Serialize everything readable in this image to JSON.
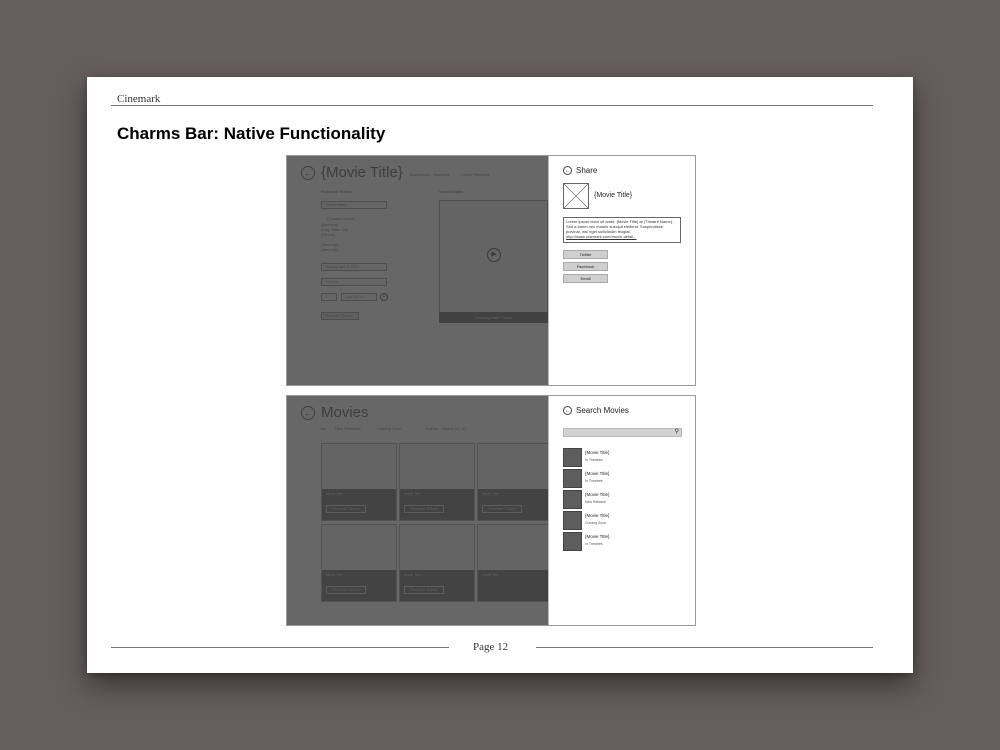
{
  "document": {
    "header": "Cinemark",
    "title": "Charms Bar: Native Functionality",
    "page_number": "Page 12"
  },
  "share_screen": {
    "app": {
      "title": "{Movie Title}",
      "nav": [
        "Showtimes",
        "Synopsis",
        "Critics' Reviews"
      ],
      "section_left": "Purchase Tickets",
      "section_right": "Movie Details",
      "theatre_select": "Theatre Name",
      "theatre_name": "{Theatre Name}",
      "address_lines": [
        "{Address}",
        "{City, State Zip}",
        "{Phone}"
      ],
      "extra_lines": [
        "{Amenity}",
        "{Amenity}"
      ],
      "date_select": "Monday, April 8, 2013",
      "time_select": "7:10 pm",
      "qty_select": "2",
      "type_select": "Adult $11.00",
      "purchase_button": "Purchase Tickets",
      "video_caption": "Opening Date: Today"
    },
    "pane": {
      "title": "Share",
      "movie_title": "{Movie Title}",
      "message_text": "Lorem ipsum dolor sit amet, {Movie Title} at {Theatre Name}. Sed a lorem nec mauris suscipit eleifend. Suspendisse pulvinar, nisi eget sollicitudin feugiat.",
      "message_link": "http://www.cinemark.com/movie-detail..."
    },
    "buttons": [
      "Twitter",
      "Facebook",
      "Email"
    ]
  },
  "search_screen": {
    "app": {
      "title": "Movies",
      "filters": [
        "All",
        "New Releases",
        "Coming Soon"
      ],
      "sort_label": "Sort by:",
      "sort_value": "Name (A - Z)",
      "tile_name": "Movie Title",
      "tile_button": "Purchase Tickets"
    },
    "pane": {
      "title": "Search Movies"
    },
    "results": [
      {
        "title": "{Movie Title}",
        "status": "In Theatres"
      },
      {
        "title": "{Movie Title}",
        "status": "In Theatres"
      },
      {
        "title": "{Movie Title}",
        "status": "New Release"
      },
      {
        "title": "{Movie Title}",
        "status": "Coming Soon"
      },
      {
        "title": "{Movie Title}",
        "status": "In Theatres"
      }
    ]
  },
  "icons": {
    "back": "back-arrow-icon",
    "play": "play-icon",
    "search": "search-icon",
    "image_placeholder": "image-placeholder-icon"
  },
  "colors": {
    "background": "#665d5d",
    "overlay": "#3c3c3c",
    "button_gray": "#cfcfcf",
    "result_thumb": "#5d5d5d"
  }
}
